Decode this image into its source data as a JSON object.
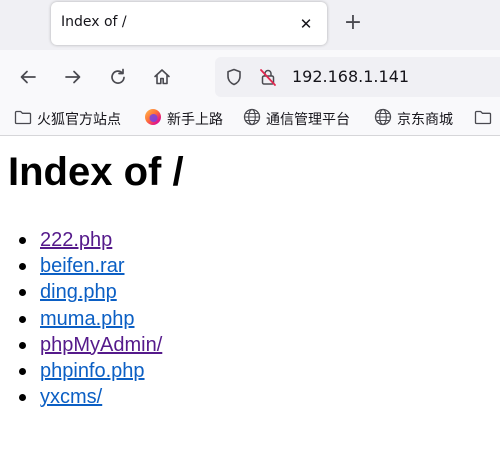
{
  "tab": {
    "title": "Index of /",
    "close_glyph": "✕",
    "new_tab_glyph": "+"
  },
  "navbar": {
    "url": "192.168.1.141",
    "icons": [
      "back-arrow-icon",
      "forward-arrow-icon",
      "reload-icon",
      "home-icon",
      "shield-icon",
      "insecure-lock-icon"
    ]
  },
  "bookmarks": [
    {
      "label": "火狐官方站点",
      "icon": "folder-icon"
    },
    {
      "label": "新手上路",
      "icon": "firefox-logo-icon"
    },
    {
      "label": "通信管理平台",
      "icon": "globe-icon"
    },
    {
      "label": "京东商城",
      "icon": "globe-icon"
    }
  ],
  "page": {
    "heading": "Index of /",
    "entries": [
      {
        "name": "222.php",
        "visited": true
      },
      {
        "name": "beifen.rar",
        "visited": false
      },
      {
        "name": "ding.php",
        "visited": false
      },
      {
        "name": "muma.php",
        "visited": false
      },
      {
        "name": "phpMyAdmin/",
        "visited": true
      },
      {
        "name": "phpinfo.php",
        "visited": false
      },
      {
        "name": "yxcms/",
        "visited": false
      }
    ]
  },
  "colors": {
    "link": "#0b5fc4",
    "visited_link": "#551a8b",
    "toolbar_bg": "#f9f9fb",
    "tabstrip_bg": "#f0f0f4",
    "insecure_red": "#e22850"
  }
}
